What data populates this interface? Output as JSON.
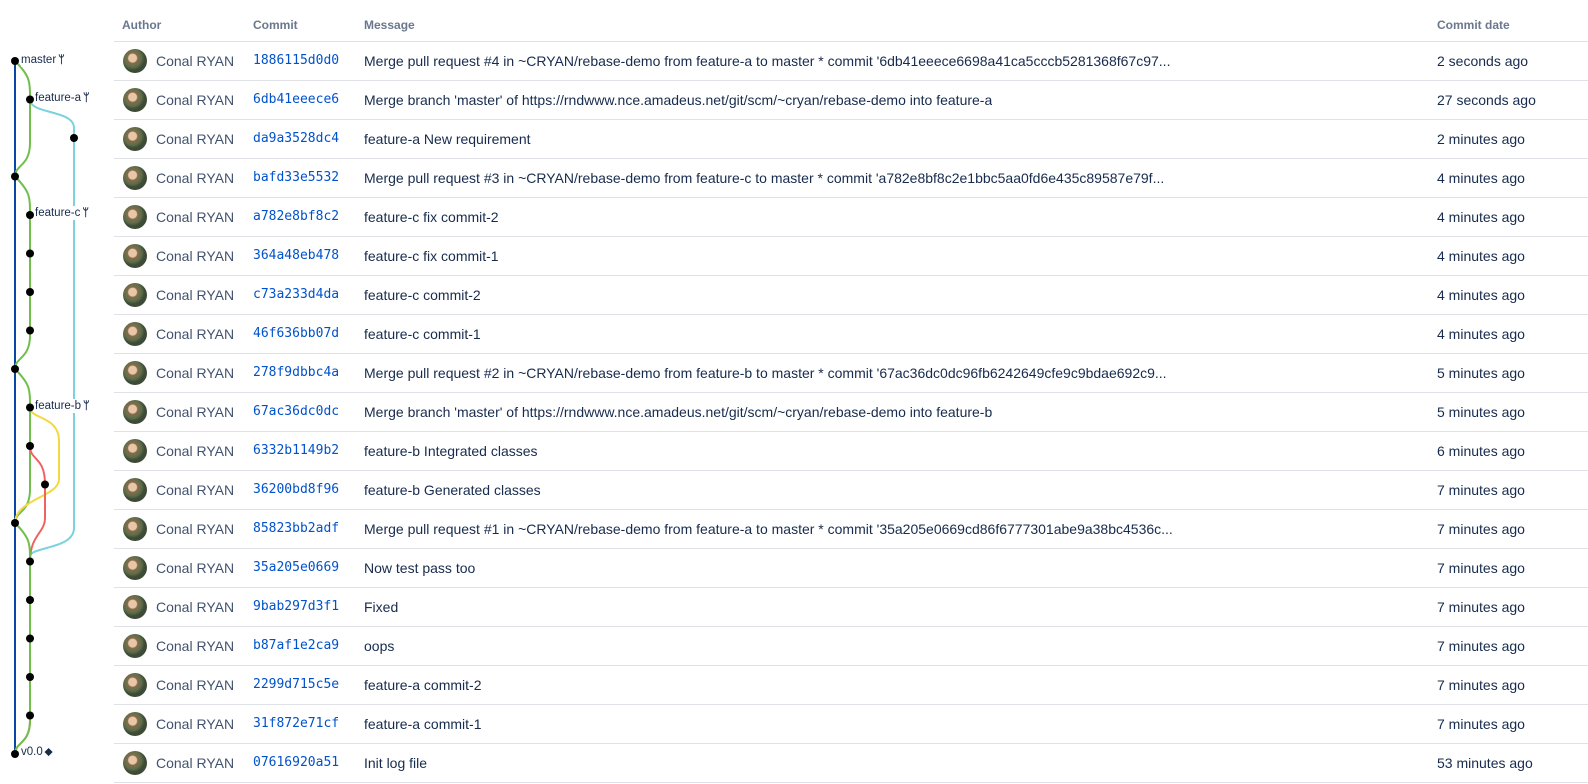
{
  "columns": {
    "author": "Author",
    "commit": "Commit",
    "message": "Message",
    "date": "Commit date"
  },
  "colors": {
    "master": "#0747a6",
    "green": "#6fbf4a",
    "cyan": "#79d2dd",
    "yellow": "#f5d742",
    "red": "#f06262",
    "node": "#000000"
  },
  "refs": {
    "master": "master",
    "feature_a": "feature-a",
    "feature_c": "feature-c",
    "feature_b": "feature-b",
    "tag": "v0.0",
    "branch_icon": "branch-icon",
    "tag_icon": "tag-icon"
  },
  "commits": [
    {
      "author": "Conal RYAN",
      "hash": "1886115d0d0",
      "message": "Merge pull request #4 in ~CRYAN/rebase-demo from feature-a to master * commit '6db41eeece6698a41ca5cccb5281368f67c97...",
      "date": "2 seconds ago"
    },
    {
      "author": "Conal RYAN",
      "hash": "6db41eeece6",
      "message": "Merge branch 'master' of https://rndwww.nce.amadeus.net/git/scm/~cryan/rebase-demo into feature-a",
      "date": "27 seconds ago"
    },
    {
      "author": "Conal RYAN",
      "hash": "da9a3528dc4",
      "message": "feature-a New requirement",
      "date": "2 minutes ago"
    },
    {
      "author": "Conal RYAN",
      "hash": "bafd33e5532",
      "message": "Merge pull request #3 in ~CRYAN/rebase-demo from feature-c to master * commit 'a782e8bf8c2e1bbc5aa0fd6e435c89587e79f...",
      "date": "4 minutes ago"
    },
    {
      "author": "Conal RYAN",
      "hash": "a782e8bf8c2",
      "message": "feature-c fix commit-2",
      "date": "4 minutes ago"
    },
    {
      "author": "Conal RYAN",
      "hash": "364a48eb478",
      "message": "feature-c fix commit-1",
      "date": "4 minutes ago"
    },
    {
      "author": "Conal RYAN",
      "hash": "c73a233d4da",
      "message": "feature-c commit-2",
      "date": "4 minutes ago"
    },
    {
      "author": "Conal RYAN",
      "hash": "46f636bb07d",
      "message": "feature-c commit-1",
      "date": "4 minutes ago"
    },
    {
      "author": "Conal RYAN",
      "hash": "278f9dbbc4a",
      "message": "Merge pull request #2 in ~CRYAN/rebase-demo from feature-b to master * commit '67ac36dc0dc96fb6242649cfe9c9bdae692c9...",
      "date": "5 minutes ago"
    },
    {
      "author": "Conal RYAN",
      "hash": "67ac36dc0dc",
      "message": "Merge branch 'master' of https://rndwww.nce.amadeus.net/git/scm/~cryan/rebase-demo into feature-b",
      "date": "5 minutes ago"
    },
    {
      "author": "Conal RYAN",
      "hash": "6332b1149b2",
      "message": "feature-b Integrated classes",
      "date": "6 minutes ago"
    },
    {
      "author": "Conal RYAN",
      "hash": "36200bd8f96",
      "message": "feature-b Generated classes",
      "date": "7 minutes ago"
    },
    {
      "author": "Conal RYAN",
      "hash": "85823bb2adf",
      "message": "Merge pull request #1 in ~CRYAN/rebase-demo from feature-a to master * commit '35a205e0669cd86f6777301abe9a38bc4536c...",
      "date": "7 minutes ago"
    },
    {
      "author": "Conal RYAN",
      "hash": "35a205e0669",
      "message": "Now test pass too",
      "date": "7 minutes ago"
    },
    {
      "author": "Conal RYAN",
      "hash": "9bab297d3f1",
      "message": "Fixed",
      "date": "7 minutes ago"
    },
    {
      "author": "Conal RYAN",
      "hash": "b87af1e2ca9",
      "message": "oops",
      "date": "7 minutes ago"
    },
    {
      "author": "Conal RYAN",
      "hash": "2299d715c5e",
      "message": "feature-a commit-2",
      "date": "7 minutes ago"
    },
    {
      "author": "Conal RYAN",
      "hash": "31f872e71cf",
      "message": "feature-a commit-1",
      "date": "7 minutes ago"
    },
    {
      "author": "Conal RYAN",
      "hash": "07616920a51",
      "message": "Init log file",
      "date": "53 minutes ago"
    }
  ]
}
